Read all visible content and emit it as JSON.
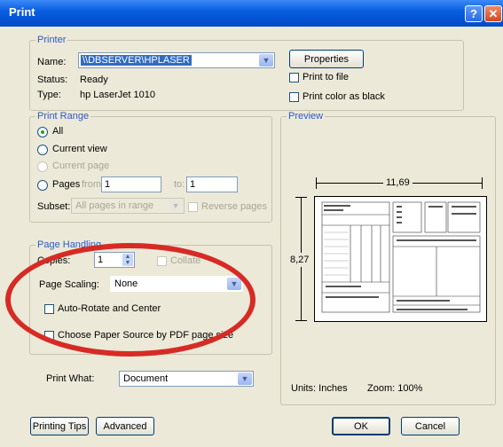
{
  "window": {
    "title": "Print"
  },
  "printer": {
    "group_label": "Printer",
    "name_label": "Name:",
    "name_value": "\\\\DBSERVER\\HPLASER",
    "status_label": "Status:",
    "status_value": "Ready",
    "type_label": "Type:",
    "type_value": "hp LaserJet 1010",
    "properties_button": "Properties",
    "print_to_file": "Print to file",
    "print_color_as_black": "Print color as black"
  },
  "print_range": {
    "group_label": "Print Range",
    "all": "All",
    "current_view": "Current view",
    "current_page": "Current page",
    "pages": "Pages",
    "from_label": "from:",
    "from_value": "1",
    "to_label": "to:",
    "to_value": "1",
    "subset_label": "Subset:",
    "subset_value": "All pages in range",
    "reverse_pages": "Reverse pages"
  },
  "page_handling": {
    "group_label": "Page Handling",
    "copies_label": "Copies:",
    "copies_value": "1",
    "collate": "Collate",
    "scaling_label": "Page Scaling:",
    "scaling_value": "None",
    "auto_rotate": "Auto-Rotate and Center",
    "choose_paper_source": "Choose Paper Source by PDF page size"
  },
  "print_what": {
    "label": "Print What:",
    "value": "Document"
  },
  "preview": {
    "group_label": "Preview",
    "width_dim": "11,69",
    "height_dim": "8,27",
    "units": "Units: Inches",
    "zoom": "Zoom: 100%"
  },
  "footer": {
    "printing_tips": "Printing Tips",
    "advanced": "Advanced",
    "ok": "OK",
    "cancel": "Cancel"
  },
  "colors": {
    "titlebar": "#0a5fe0",
    "group_label": "#2c59c8",
    "annotation_oval": "#d62b25"
  }
}
